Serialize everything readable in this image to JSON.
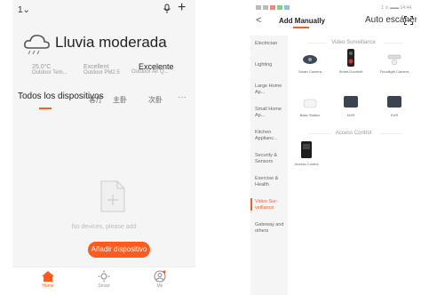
{
  "left_phone": {
    "top_left": "1⌄",
    "weather": {
      "condition": "Lluvia moderada"
    },
    "stats": [
      {
        "value": "25.0°C",
        "label": "Outdoor Tem..."
      },
      {
        "value": "Excellent",
        "label": "Outdoor PM2.5"
      },
      {
        "value": "Excellent",
        "label": "Outdoor Air Q..."
      }
    ],
    "air_quality_overlay": "Excelente",
    "tabs": {
      "all_devices": "Todos los dispositivos",
      "tab2": "客厅",
      "tab3": "主卧",
      "tab4": "次卧",
      "more": "···"
    },
    "empty_state": "No devices, please add",
    "add_button": "Añadir dispositivo",
    "nav": [
      {
        "label": "Home",
        "icon": "home-icon"
      },
      {
        "label": "Smart",
        "icon": "sun-icon"
      },
      {
        "label": "Me",
        "icon": "profile-icon"
      }
    ],
    "accent_color": "#ff5a1f"
  },
  "right_phone": {
    "status_time": "1 ⊙ ▬▬ 14:44",
    "back": "<",
    "tab_add_manually": "Add Manually",
    "tab_auto_scan": "Auto escáner",
    "categories": [
      "Electrician",
      "Lighting",
      "Large Home Ap...",
      "Small Home Ap...",
      "Kitchen Applianc...",
      "Security & Sensors",
      "Exercise & Health",
      "Video Sur-veillance",
      "Gateway and others"
    ],
    "active_category": "Video Sur-veillance",
    "sections": [
      {
        "title": "Video Surveillance",
        "devices": [
          "Smart Camera",
          "Smart Doorbell",
          "Floodlight Camera",
          "Base Station",
          "NVR",
          "DVR"
        ]
      },
      {
        "title": "Access Control",
        "devices": [
          "Access Control"
        ]
      }
    ]
  }
}
